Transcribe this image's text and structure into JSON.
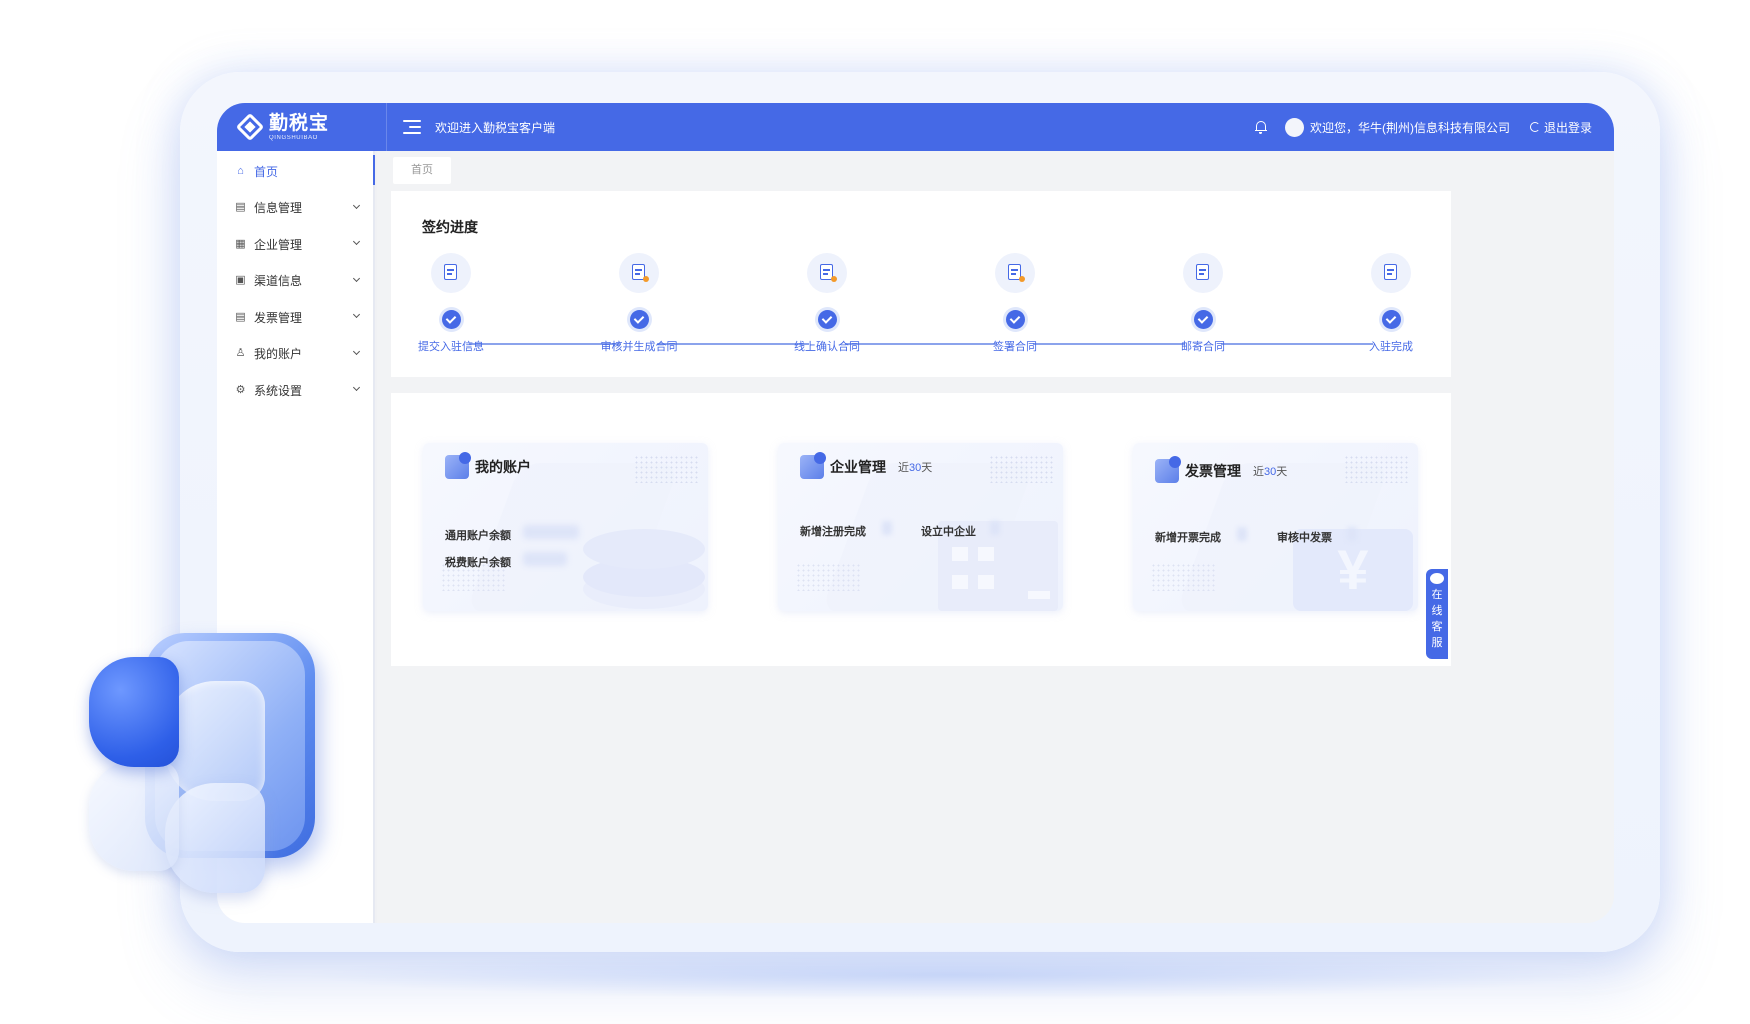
{
  "brand": {
    "name_cn": "勤税宝",
    "name_en": "QINGSHUIBAO"
  },
  "header": {
    "welcome_title": "欢迎进入勤税宝客户端",
    "user_greeting": "欢迎您，华牛(荆州)信息科技有限公司",
    "logout_label": "退出登录"
  },
  "sidebar": {
    "items": [
      {
        "label": "首页",
        "icon": "home-icon",
        "active": true
      },
      {
        "label": "信息管理",
        "icon": "info-doc-icon"
      },
      {
        "label": "企业管理",
        "icon": "grid-icon"
      },
      {
        "label": "渠道信息",
        "icon": "channel-icon"
      },
      {
        "label": "发票管理",
        "icon": "invoice-icon"
      },
      {
        "label": "我的账户",
        "icon": "user-icon"
      },
      {
        "label": "系统设置",
        "icon": "gear-icon"
      }
    ]
  },
  "tabs": {
    "home": "首页"
  },
  "progress": {
    "title": "签约进度",
    "steps": [
      {
        "label": "提交入驻信息",
        "completed": true
      },
      {
        "label": "审核并生成合同",
        "completed": true
      },
      {
        "label": "线上确认合同",
        "completed": true
      },
      {
        "label": "签署合同",
        "completed": true
      },
      {
        "label": "邮寄合同",
        "completed": true
      },
      {
        "label": "入驻完成",
        "completed": true
      }
    ]
  },
  "panels": {
    "account": {
      "title": "我的账户",
      "general_balance_label": "通用账户余额",
      "tax_balance_label": "税费账户余额"
    },
    "enterprise": {
      "title": "企业管理",
      "period_prefix": "近",
      "period_num": "30",
      "period_suffix": "天",
      "new_registered_label": "新增注册完成",
      "establishing_label": "设立中企业"
    },
    "invoice": {
      "title": "发票管理",
      "period_prefix": "近",
      "period_num": "30",
      "period_suffix": "天",
      "new_invoiced_label": "新增开票完成",
      "reviewing_label": "审核中发票"
    }
  },
  "service": {
    "chars": [
      "在",
      "线",
      "客",
      "服"
    ]
  },
  "colors": {
    "primary": "#4569e6",
    "accent_orange": "#f39a2a"
  }
}
